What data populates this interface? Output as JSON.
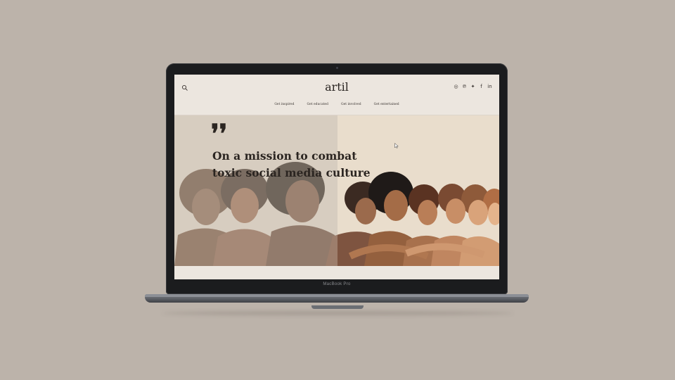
{
  "device": {
    "label": "MacBook Pro"
  },
  "site": {
    "logo": "artil",
    "nav": [
      {
        "label": "Get inspired"
      },
      {
        "label": "Get educated"
      },
      {
        "label": "Get involved"
      },
      {
        "label": "Get entertained"
      }
    ],
    "socials": [
      {
        "icon": "instagram-icon",
        "glyph": "◎"
      },
      {
        "icon": "pinterest-icon",
        "glyph": "℗"
      },
      {
        "icon": "twitter-icon",
        "glyph": "✦"
      },
      {
        "icon": "facebook-icon",
        "glyph": "f"
      },
      {
        "icon": "linkedin-icon",
        "glyph": "in"
      }
    ]
  },
  "hero": {
    "quote_mark": "❜❜",
    "headline_line1": "On a mission to combat",
    "headline_line2": "toxic social media culture"
  },
  "colors": {
    "background": "#bcb3aa",
    "page": "#ece6df",
    "text": "#2b2521"
  }
}
